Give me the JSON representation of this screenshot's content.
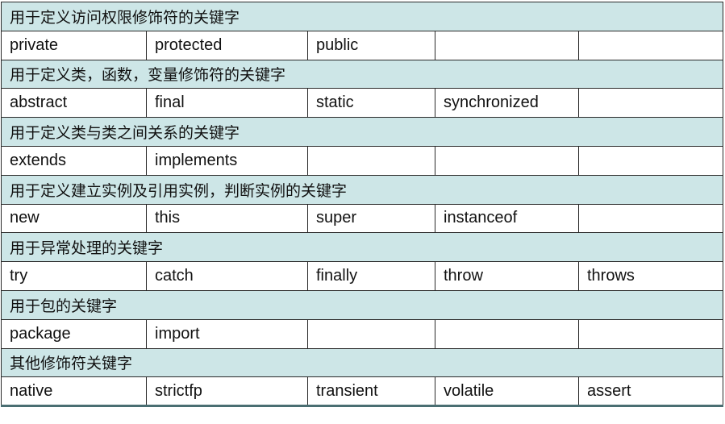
{
  "colors": {
    "header_bg": "#cde6e7",
    "border": "#2a2a2a"
  },
  "groups": [
    {
      "title": "用于定义访问权限修饰符的关键字",
      "keywords": [
        "private",
        "protected",
        "public",
        "",
        ""
      ]
    },
    {
      "title": "用于定义类，函数，变量修饰符的关键字",
      "keywords": [
        "abstract",
        "final",
        "static",
        "synchronized",
        ""
      ]
    },
    {
      "title": "用于定义类与类之间关系的关键字",
      "keywords": [
        "extends",
        "implements",
        "",
        "",
        ""
      ]
    },
    {
      "title": "用于定义建立实例及引用实例，判断实例的关键字",
      "keywords": [
        "new",
        "this",
        "super",
        "instanceof",
        ""
      ]
    },
    {
      "title": "用于异常处理的关键字",
      "keywords": [
        "try",
        "catch",
        "finally",
        "throw",
        "throws"
      ]
    },
    {
      "title": "用于包的关键字",
      "keywords": [
        "package",
        "import",
        "",
        "",
        ""
      ]
    },
    {
      "title": "其他修饰符关键字",
      "keywords": [
        "native",
        "strictfp",
        "transient",
        "volatile",
        "assert"
      ]
    }
  ]
}
